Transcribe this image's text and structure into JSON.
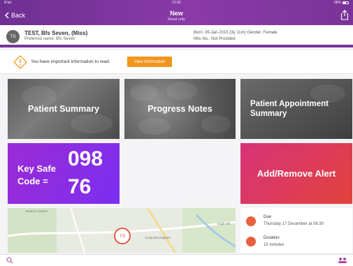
{
  "status": {
    "carrier": "iPad",
    "time": "15:56",
    "battery": "58%"
  },
  "nav": {
    "back": "Back",
    "title": "New",
    "subtitle": "Read only"
  },
  "patient": {
    "initials": "TS",
    "name": "TEST, Bfs Seven, (Miss)",
    "preferred": "Preferred name: Bfs Seven",
    "born": "Born: 05-Jan-2015 (3y 11m)   Gender: Female",
    "nhs": "Nhs No.: Not Provided"
  },
  "alert": {
    "text": "You have important information to read.",
    "button": "View Information"
  },
  "tiles": {
    "summary": "Patient Summary",
    "progress": "Progress Notes",
    "appt": "Patient Appointment Summary",
    "keysafe_label_1": "Key Safe",
    "keysafe_label_2": "Code =",
    "keysafe_code_top": "098",
    "keysafe_code_bottom": "76",
    "add_alert": "Add/Remove Alert"
  },
  "map": {
    "pin": "TS",
    "labels": [
      "Botanic Garden",
      "Cindy Birmingham",
      "Edgb Hill"
    ]
  },
  "appointment": {
    "due_label": "Due",
    "due_value": "Thursday 17 December at 08:30",
    "duration_label": "Duration",
    "duration_value": "15 minutes"
  },
  "colors": {
    "header": "#7a3399",
    "accent": "#f0961e",
    "keysafe": "#8a2de0",
    "alert_tile": "#dc3a5a"
  },
  "icons": [
    "back-chevron-icon",
    "share-icon",
    "warning-icon",
    "calendar-icon",
    "clock-icon",
    "search-icon",
    "team-icon"
  ]
}
